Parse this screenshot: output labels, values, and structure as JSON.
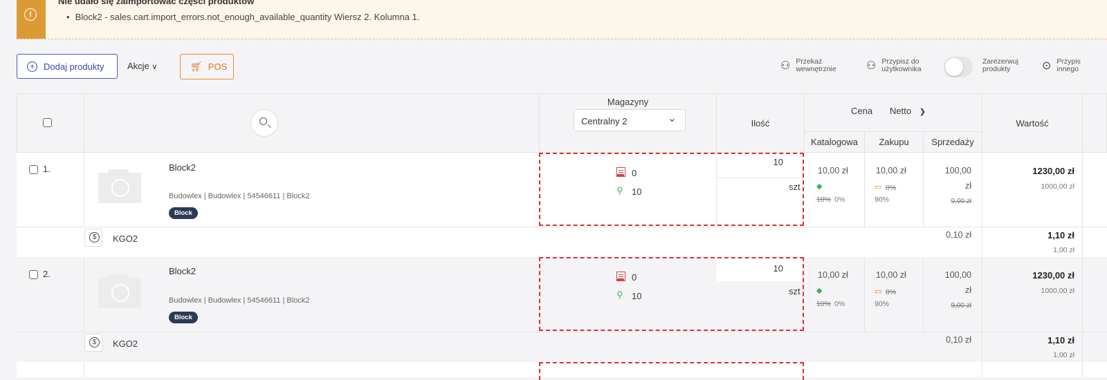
{
  "alert": {
    "title": "Nie udało się zaimportować części produktów",
    "item": "Block2 - sales.cart.import_errors.not_enough_available_quantity Wiersz 2. Kolumna 1."
  },
  "toolbar": {
    "add_label": "Dodaj produkty",
    "actions_label": "Akcje",
    "pos_label": "POS",
    "transfer_l1": "Przekaż",
    "transfer_l2": "wewnętrznie",
    "assign_l1": "Przypisz do",
    "assign_l2": "użytkownika",
    "reserve_l1": "Zarezerwuj",
    "reserve_l2": "produkty",
    "assign_other_l1": "Przypis",
    "assign_other_l2": "innego"
  },
  "table": {
    "col_warehouses": "Magazyny",
    "warehouse_selected": "Centralny 2",
    "col_quantity": "Ilość",
    "col_price": "Cena",
    "price_mode": "Netto",
    "col_catalog": "Katalogowa",
    "col_purchase": "Zakupu",
    "col_sale": "Sprzedaży",
    "col_value": "Wartość"
  },
  "rows": [
    {
      "index": "1.",
      "name": "Block2",
      "meta": "Budowlex | Budowlex | 54546611 | Block2",
      "badge": "Block",
      "stock_reserved": "0",
      "stock_available": "10",
      "qty": "10",
      "unit": "szt",
      "catalog": "10,00 zł",
      "catalog_disc_old": "10%",
      "catalog_disc_new": "0%",
      "purchase": "10,00 zł",
      "purchase_old": "0%",
      "purchase_margin": "90%",
      "sale_l1": "100,00",
      "sale_l2": "zł",
      "sale_old": "9,00 zł",
      "value_gross": "1230,00 zł",
      "value_net": "1000,00 zł",
      "sub_code": "KGO2",
      "sub_sale": "0,10 zł",
      "sub_value_gross": "1,10 zł",
      "sub_value_net": "1,00 zł"
    },
    {
      "index": "2.",
      "name": "Block2",
      "meta": "Budowlex | Budowlex | 54546611 | Block2",
      "badge": "Block",
      "stock_reserved": "0",
      "stock_available": "10",
      "qty": "10",
      "unit": "szt",
      "catalog": "10,00 zł",
      "catalog_disc_old": "10%",
      "catalog_disc_new": "0%",
      "purchase": "10,00 zł",
      "purchase_old": "0%",
      "purchase_margin": "90%",
      "sale_l1": "100,00",
      "sale_l2": "zł",
      "sale_old": "9,00 zł",
      "value_gross": "1230,00 zł",
      "value_net": "1000,00 zł",
      "sub_code": "KGO2",
      "sub_sale": "0,10 zł",
      "sub_value_gross": "1,10 zł",
      "sub_value_net": "1,00 zł"
    }
  ]
}
